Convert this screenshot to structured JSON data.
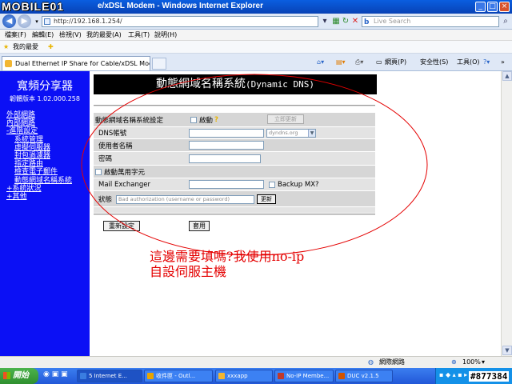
{
  "window": {
    "logo_text": "MOBILE01",
    "title": "e/xDSL Modem - Windows Internet Explorer",
    "minimize": "_",
    "maximize": "□",
    "close": "×"
  },
  "address_bar": {
    "url": "http://192.168.1.254/",
    "search_placeholder": "Live Search",
    "search_logo": "b"
  },
  "menu": [
    "檔案(F)",
    "編輯(E)",
    "檢視(V)",
    "我的最愛(A)",
    "工具(T)",
    "說明(H)"
  ],
  "favorites_bar": {
    "label": "我的最愛"
  },
  "tab": {
    "label": "Dual Ethernet IP Share for Cable/xDSL Modem"
  },
  "command_bar": {
    "page": "網頁(P)",
    "safety": "安全性(S)",
    "tools": "工具(O)"
  },
  "sidebar": {
    "title": "寬頻分享器",
    "firmware": "韌體版本 1.02.000.258",
    "nav": [
      {
        "label": "外部網路",
        "sub": false
      },
      {
        "label": "內部網路",
        "sub": false
      },
      {
        "label": "-進階設定",
        "sub": false
      },
      {
        "label": "系統管理",
        "sub": true
      },
      {
        "label": "虛擬伺服器",
        "sub": true
      },
      {
        "label": "封包過濾器",
        "sub": true
      },
      {
        "label": "指定路由",
        "sub": true
      },
      {
        "label": "檢查電子郵件",
        "sub": true
      },
      {
        "label": "動態網域名稱系統",
        "sub": true
      },
      {
        "label": "+系統狀況",
        "sub": false
      },
      {
        "label": "+其他",
        "sub": false
      }
    ]
  },
  "ddns": {
    "header_zh": "動態網域名稱系統",
    "header_en": "(Dynamic DNS)",
    "settings_label": "動態網域名稱系統設定",
    "enable_label": "啟動",
    "enable_checked": false,
    "update_now_button": "立即更新",
    "dns_account_label": "DNS帳號",
    "dns_account_value": "",
    "provider_value": "dyndns.org",
    "username_label": "使用者名稱",
    "username_value": "",
    "password_label": "密碼",
    "password_value": "",
    "wildcard_label": "啟動萬用字元",
    "wildcard_checked": false,
    "mail_exchanger_label": "Mail Exchanger",
    "mail_exchanger_value": "",
    "backup_mx_label": "Backup MX?",
    "backup_mx_checked": false,
    "status_label": "狀態",
    "status_value": "Bad authorization (username or password)",
    "refresh_button": "更新",
    "reset_button": "重新設定",
    "apply_button": "套用"
  },
  "annotation": {
    "line1": "這邊需要填嗎?我使用no-ip",
    "line2": "自設伺服主機",
    "color": "#e40000"
  },
  "status_bar": {
    "zone": "網際網路",
    "zoom": "100%"
  },
  "taskbar": {
    "start": "開始",
    "tasks": [
      {
        "label": "5 Internet E...",
        "active": true
      },
      {
        "label": "收件匣 - Outl...",
        "active": false
      },
      {
        "label": "xxxapp",
        "active": false
      },
      {
        "label": "No-IP Membe...",
        "active": false
      },
      {
        "label": "DUC v2.1.5",
        "active": false
      }
    ]
  },
  "watermark": "#877384"
}
